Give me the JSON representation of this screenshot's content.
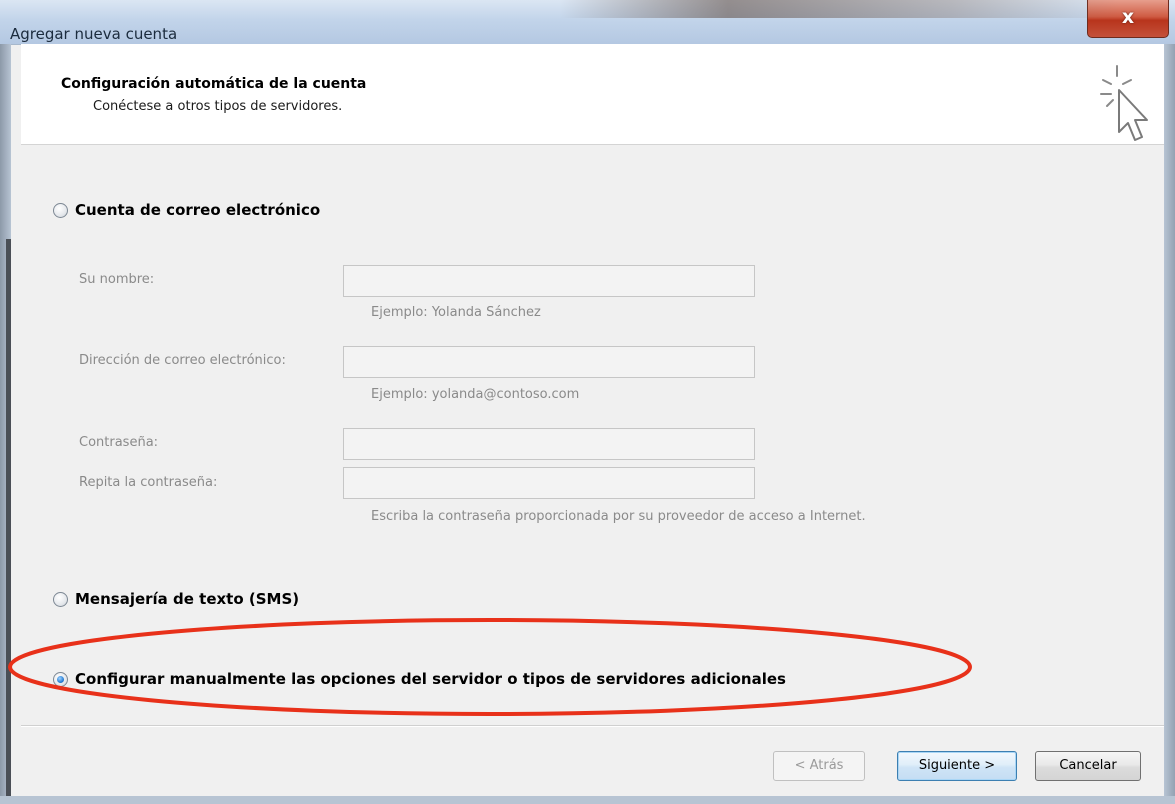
{
  "window": {
    "title": "Agregar nueva cuenta",
    "close_glyph": "x"
  },
  "header": {
    "title": "Configuración automática de la cuenta",
    "subtitle": "Conéctese a otros tipos de servidores.",
    "icon": "wizard-cursor-icon"
  },
  "options": {
    "email_account": {
      "label": "Cuenta de correo electrónico",
      "checked": false
    },
    "sms": {
      "label": "Mensajería de texto (SMS)",
      "checked": false
    },
    "manual": {
      "label": "Configurar manualmente las opciones del servidor o tipos de servidores adicionales",
      "checked": true
    }
  },
  "form": {
    "name": {
      "label": "Su nombre:",
      "value": "",
      "hint": "Ejemplo: Yolanda Sánchez"
    },
    "email": {
      "label": "Dirección de correo electrónico:",
      "value": "",
      "hint": "Ejemplo: yolanda@contoso.com"
    },
    "password": {
      "label": "Contraseña:",
      "value": ""
    },
    "password_repeat": {
      "label": "Repita la contraseña:",
      "value": "",
      "hint": "Escriba la contraseña proporcionada por su proveedor de acceso a Internet."
    }
  },
  "buttons": {
    "back": "< Atrás",
    "next": "Siguiente >",
    "cancel": "Cancelar"
  },
  "colors": {
    "highlight": "#e8311a",
    "accent": "#3c7fb1",
    "disabled_text": "#8a8a8a"
  }
}
